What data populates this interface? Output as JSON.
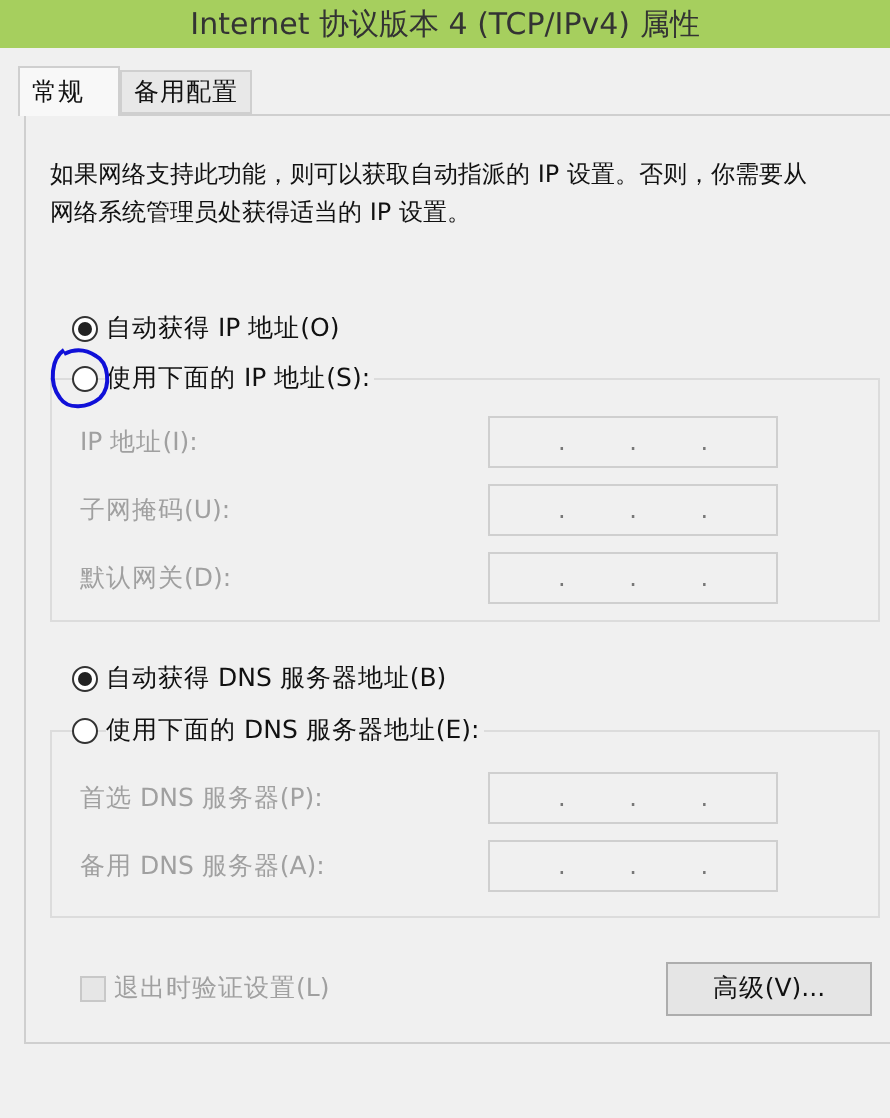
{
  "window": {
    "title": "Internet 协议版本 4 (TCP/IPv4) 属性"
  },
  "tabs": [
    {
      "label": "常规",
      "selected": true
    },
    {
      "label": "备用配置",
      "selected": false
    }
  ],
  "description": "如果网络支持此功能，则可以获取自动指派的 IP 设置。否则，你需要从网络系统管理员处获得适当的 IP 设置。",
  "ip_options": [
    {
      "label": "自动获得 IP 地址(O)",
      "selected": true
    },
    {
      "label": "使用下面的 IP 地址(S):",
      "selected": false
    }
  ],
  "ip_fields": [
    {
      "label": "IP 地址(I):",
      "value": ". . .",
      "disabled": true
    },
    {
      "label": "子网掩码(U):",
      "value": ". . .",
      "disabled": true
    },
    {
      "label": "默认网关(D):",
      "value": ". . .",
      "disabled": true
    }
  ],
  "dns_options": [
    {
      "label": "自动获得 DNS 服务器地址(B)",
      "selected": true
    },
    {
      "label": "使用下面的 DNS 服务器地址(E):",
      "selected": false
    }
  ],
  "dns_fields": [
    {
      "label": "首选 DNS 服务器(P):",
      "value": ". . .",
      "disabled": true
    },
    {
      "label": "备用 DNS 服务器(A):",
      "value": ". . .",
      "disabled": true
    }
  ],
  "validate_checkbox": {
    "label": "退出时验证设置(L)",
    "checked": false,
    "disabled": true
  },
  "advanced_button": {
    "label": "高级(V)..."
  }
}
